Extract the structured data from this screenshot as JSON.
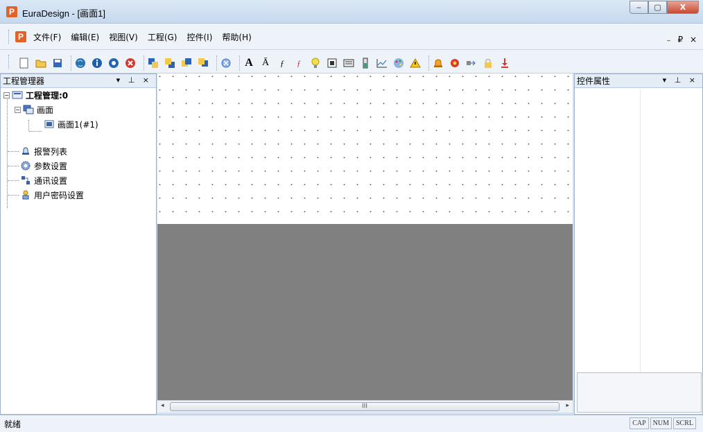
{
  "window": {
    "title": "EuraDesign - [画面1]",
    "logo_letter": "P",
    "min_label": "▭",
    "max_label": "▣",
    "close_label": "X"
  },
  "menu": {
    "logo_letter": "P",
    "items": [
      {
        "label": "文件(F)"
      },
      {
        "label": "编辑(E)"
      },
      {
        "label": "视图(V)"
      },
      {
        "label": "工程(G)"
      },
      {
        "label": "控件(I)"
      },
      {
        "label": "帮助(H)"
      }
    ],
    "mdi_controls": "₋ ₽ ×"
  },
  "toolbar": {
    "icons": [
      "new-file-icon",
      "open-folder-icon",
      "save-icon",
      "globe-icon",
      "info-icon",
      "record-icon",
      "stop-icon",
      "front-icon",
      "back-icon",
      "forward-icon",
      "backward-icon",
      "target-icon",
      "text-icon",
      "multi-text-icon",
      "numeric-icon",
      "formula-icon",
      "lamp-icon",
      "button-icon",
      "keypad-icon",
      "meter-icon",
      "trend-icon",
      "palette-icon",
      "warning-icon",
      "bell-icon",
      "gear-icon",
      "transfer-icon",
      "lock-icon",
      "download-icon"
    ]
  },
  "project_panel": {
    "title": "工程管理器",
    "controls": "▾ ⊥ ×",
    "root": "工程管理:0",
    "screens_node": "画面",
    "screen_item": "画面1(#1)",
    "alarm_list": "报警列表",
    "params": "参数设置",
    "comm": "通讯设置",
    "password": "用户密码设置"
  },
  "props_panel": {
    "title": "控件属性",
    "controls": "▾ ⊥ ×"
  },
  "scrollbar": {
    "left_arrow": "◂",
    "right_arrow": "▸",
    "thumb_grip": "III"
  },
  "status": {
    "text": "就绪",
    "indicators": [
      "CAP",
      "NUM",
      "SCRL"
    ]
  }
}
